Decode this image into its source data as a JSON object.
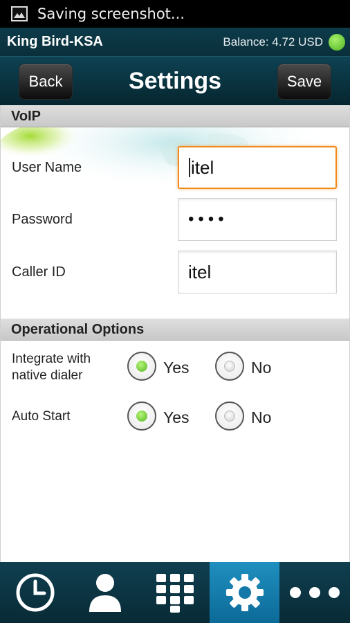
{
  "status_bar": {
    "text": "Saving screenshot...",
    "icon": "image-icon"
  },
  "account": {
    "name": "King Bird-KSA",
    "balance": "Balance: 4.72 USD",
    "online_color": "#5cc02a"
  },
  "header": {
    "title": "Settings",
    "back_label": "Back",
    "save_label": "Save"
  },
  "voip": {
    "section_title": "VoIP",
    "fields": [
      {
        "label": "User Name",
        "value": "itel",
        "focused": true
      },
      {
        "label": "Password",
        "value": "••••",
        "masked": true
      },
      {
        "label": "Caller ID",
        "value": "itel"
      }
    ]
  },
  "operational": {
    "section_title": "Operational Options",
    "options": [
      {
        "label_line1": "Integrate with",
        "label_line2": "native dialer",
        "yes_label": "Yes",
        "no_label": "No",
        "selected": "Yes"
      },
      {
        "label_line1": "Auto Start",
        "yes_label": "Yes",
        "no_label": "No",
        "selected": "Yes"
      }
    ]
  },
  "tabs": [
    {
      "icon": "clock-icon"
    },
    {
      "icon": "contacts-icon"
    },
    {
      "icon": "keypad-icon"
    },
    {
      "icon": "settings-gear-icon",
      "active": true
    },
    {
      "icon": "more-icon"
    }
  ],
  "colors": {
    "accent": "#1f8fbf",
    "focus": "#f08a1a",
    "header_bg": "#0d3b4a"
  }
}
